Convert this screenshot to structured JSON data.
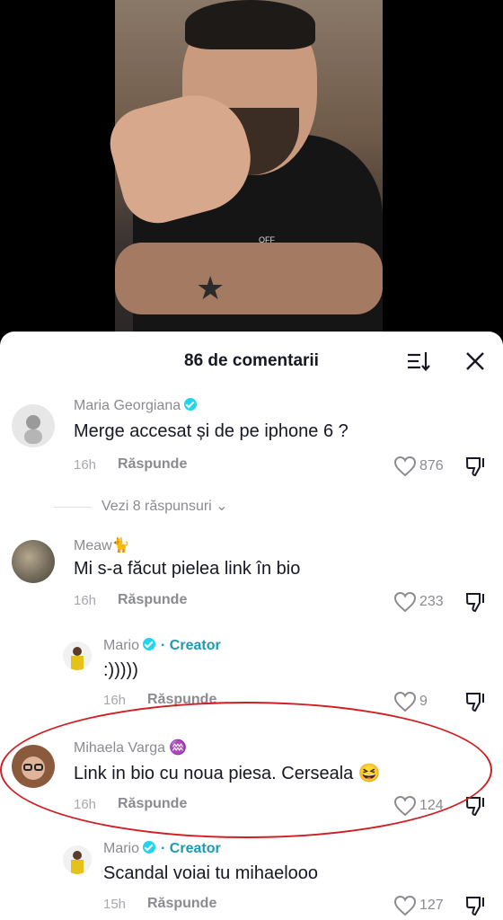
{
  "video": {
    "shirt_text": "OFF"
  },
  "sheet": {
    "title": "86 de comentarii"
  },
  "comments": [
    {
      "name": "Maria Georgiana",
      "verified": true,
      "text": "Merge accesat și de pe iphone 6 ?",
      "time": "16h",
      "reply": "Răspunde",
      "likes": "876"
    },
    {
      "view_replies": "Vezi 8 răspunsuri ⌄"
    },
    {
      "name": "Meaw🐈",
      "text": "Mi s-a făcut pielea link în bio",
      "time": "16h",
      "reply": "Răspunde",
      "likes": "233"
    },
    {
      "name": "Mario",
      "verified": true,
      "creator": "· Creator",
      "text": ":)))))",
      "time": "16h",
      "reply": "Răspunde",
      "likes": "9"
    },
    {
      "name": "Mihaela Varga ♒",
      "text": "Link in bio cu noua piesa. Cerseala 😆",
      "time": "16h",
      "reply": "Răspunde",
      "likes": "124"
    },
    {
      "name": "Mario",
      "verified": true,
      "creator": "· Creator",
      "text": "Scandal voiai tu mihaelooo",
      "time": "15h",
      "reply": "Răspunde",
      "likes": "127"
    }
  ],
  "colors": {
    "accent": "#20d5ec",
    "creator": "#1b9bb0",
    "annotation": "#d01e22"
  }
}
